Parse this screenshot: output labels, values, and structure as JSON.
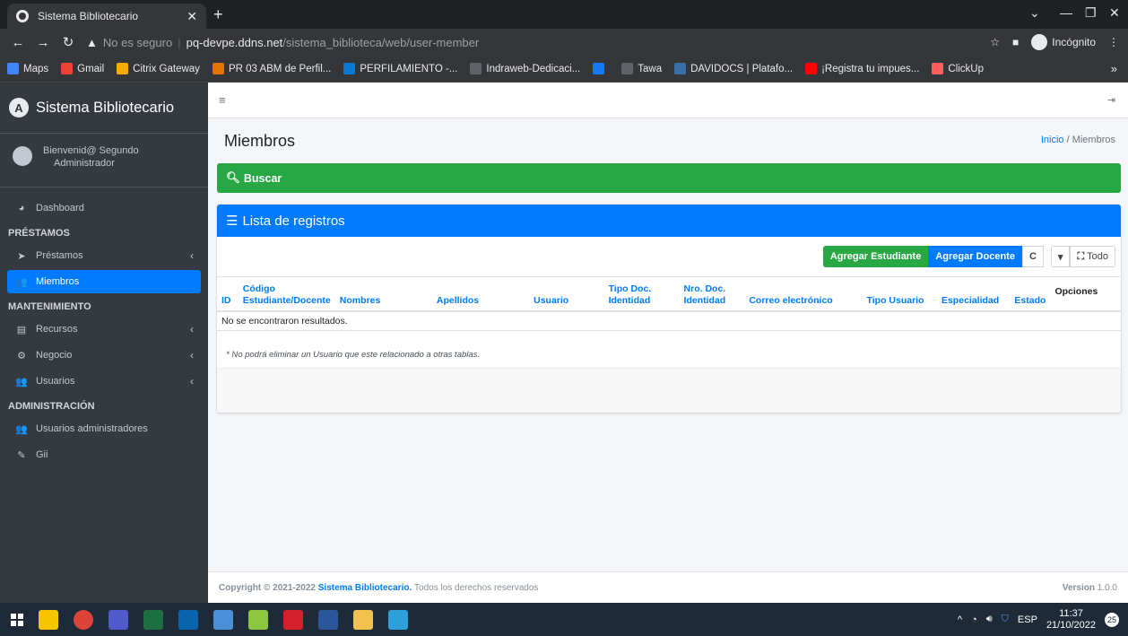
{
  "browser": {
    "tab_title": "Sistema Bibliotecario",
    "tab_close": "✕",
    "new_tab": "+",
    "url_warning": "No es seguro",
    "url_host": "pq-devpe.ddns.net",
    "url_path": "/sistema_biblioteca/web/user-member",
    "incognito": "Incógnito",
    "bookmarks": [
      {
        "label": "Maps",
        "color": "#4285f4"
      },
      {
        "label": "Gmail",
        "color": "#ea4335"
      },
      {
        "label": "Citrix Gateway",
        "color": "#f9ab00"
      },
      {
        "label": "PR 03 ABM de Perfil...",
        "color": "#e37400"
      },
      {
        "label": "PERFILAMIENTO -...",
        "color": "#0b78d1"
      },
      {
        "label": "Indraweb-Dedicaci...",
        "color": "#5f6368"
      },
      {
        "label": "",
        "color": "#1877f2"
      },
      {
        "label": "Tawa",
        "color": "#5f6368"
      },
      {
        "label": "DAVIDOCS | Platafo...",
        "color": "#3b6ea5"
      },
      {
        "label": "¡Registra tu impues...",
        "color": "#ff0000"
      },
      {
        "label": "ClickUp",
        "color": "#fd5f5f"
      }
    ],
    "bookmarks_more": "»"
  },
  "sidebar": {
    "brand": "Sistema Bibliotecario",
    "user_line1": "Bienvenid@ Segundo",
    "user_line2": "Administrador",
    "items": [
      {
        "type": "item",
        "label": "Dashboard",
        "icon": "dashboard-icon",
        "glyph": "◕"
      },
      {
        "type": "header",
        "label": "PRÉSTAMOS"
      },
      {
        "type": "item",
        "label": "Préstamos",
        "icon": "paper-plane-icon",
        "glyph": "➤",
        "chev": "‹"
      },
      {
        "type": "item",
        "label": "Miembros",
        "icon": "users-icon",
        "glyph": "👥",
        "active": true
      },
      {
        "type": "header",
        "label": "MANTENIMIENTO"
      },
      {
        "type": "item",
        "label": "Recursos",
        "icon": "list-icon",
        "glyph": "▤",
        "chev": "‹"
      },
      {
        "type": "item",
        "label": "Negocio",
        "icon": "cogs-icon",
        "glyph": "⚙",
        "chev": "‹"
      },
      {
        "type": "item",
        "label": "Usuarios",
        "icon": "users-cog-icon",
        "glyph": "👥",
        "chev": "‹"
      },
      {
        "type": "header",
        "label": "ADMINISTRACIÓN"
      },
      {
        "type": "item",
        "label": "Usuarios administradores",
        "icon": "users-icon",
        "glyph": "👥"
      },
      {
        "type": "item",
        "label": "Gii",
        "icon": "edit-icon",
        "glyph": "✎"
      }
    ]
  },
  "main": {
    "page_title": "Miembros",
    "breadcrumb_home": "Inicio",
    "breadcrumb_sep": "/",
    "breadcrumb_current": "Miembros",
    "search_label": "Buscar",
    "list_title": "Lista de registros",
    "btn_add_student": "Agregar Estudiante",
    "btn_add_teacher": "Agregar Docente",
    "btn_refresh": "C",
    "btn_toggle": "▾",
    "btn_all": "Todo",
    "columns": [
      {
        "line1": "",
        "line2": "ID"
      },
      {
        "line1": "Código",
        "line2": "Estudiante/Docente"
      },
      {
        "line1": "",
        "line2": "Nombres"
      },
      {
        "line1": "",
        "line2": "Apellidos"
      },
      {
        "line1": "",
        "line2": "Usuario"
      },
      {
        "line1": "Tipo Doc.",
        "line2": "Identidad"
      },
      {
        "line1": "Nro. Doc.",
        "line2": "Identidad"
      },
      {
        "line1": "",
        "line2": "Correo electrónico"
      },
      {
        "line1": "",
        "line2": "Tipo Usuario"
      },
      {
        "line1": "",
        "line2": "Especialidad"
      },
      {
        "line1": "",
        "line2": "Estado"
      },
      {
        "line1": "",
        "line2": "Opciones"
      }
    ],
    "empty_message": "No se encontraron resultados.",
    "note": "* No podrá eliminar un Usuario que este relacionado a otras tablas."
  },
  "footer": {
    "copyright": "Copyright © 2021-2022",
    "brand_link": "Sistema Bibliotecario.",
    "rights": "Todos los derechos reservados",
    "version_label": "Version",
    "version_value": "1.0.0"
  },
  "taskbar": {
    "lang": "ESP",
    "time": "11:37",
    "date": "21/10/2022",
    "notif_count": "25"
  },
  "colors": {
    "primary": "#007bff",
    "success": "#28a745",
    "sidebar_bg": "#343a40"
  }
}
